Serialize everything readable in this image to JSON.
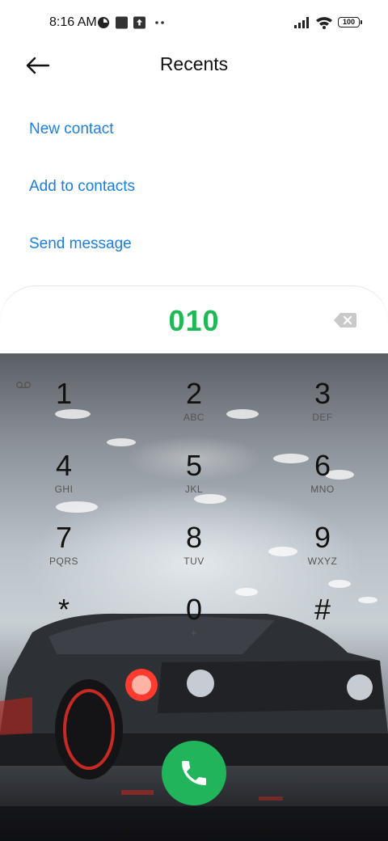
{
  "status_bar": {
    "time": "8:16 AM",
    "battery": "100",
    "icons": [
      "data-saver-icon",
      "square-notification-icon",
      "upload-icon",
      "more-dots-icon",
      "signal-icon",
      "wifi-icon",
      "battery-icon"
    ]
  },
  "header": {
    "title": "Recents",
    "back_icon": "arrow-left-icon"
  },
  "actions": [
    {
      "label": "New contact"
    },
    {
      "label": "Add to contacts"
    },
    {
      "label": "Send message"
    }
  ],
  "dialer": {
    "number": "010",
    "keys": [
      {
        "digit": "1",
        "letters": ""
      },
      {
        "digit": "2",
        "letters": "ABC"
      },
      {
        "digit": "3",
        "letters": "DEF"
      },
      {
        "digit": "4",
        "letters": "GHI"
      },
      {
        "digit": "5",
        "letters": "JKL"
      },
      {
        "digit": "6",
        "letters": "MNO"
      },
      {
        "digit": "7",
        "letters": "PQRS"
      },
      {
        "digit": "8",
        "letters": "TUV"
      },
      {
        "digit": "9",
        "letters": "WXYZ"
      },
      {
        "digit": "*",
        "letters": ""
      },
      {
        "digit": "0",
        "letters": "+"
      },
      {
        "digit": "#",
        "letters": ""
      }
    ],
    "call_icon": "phone-icon",
    "delete_icon": "backspace-icon"
  },
  "colors": {
    "accent_link": "#1a7fe0",
    "number_green": "#1db954",
    "call_button": "#21b45b"
  }
}
